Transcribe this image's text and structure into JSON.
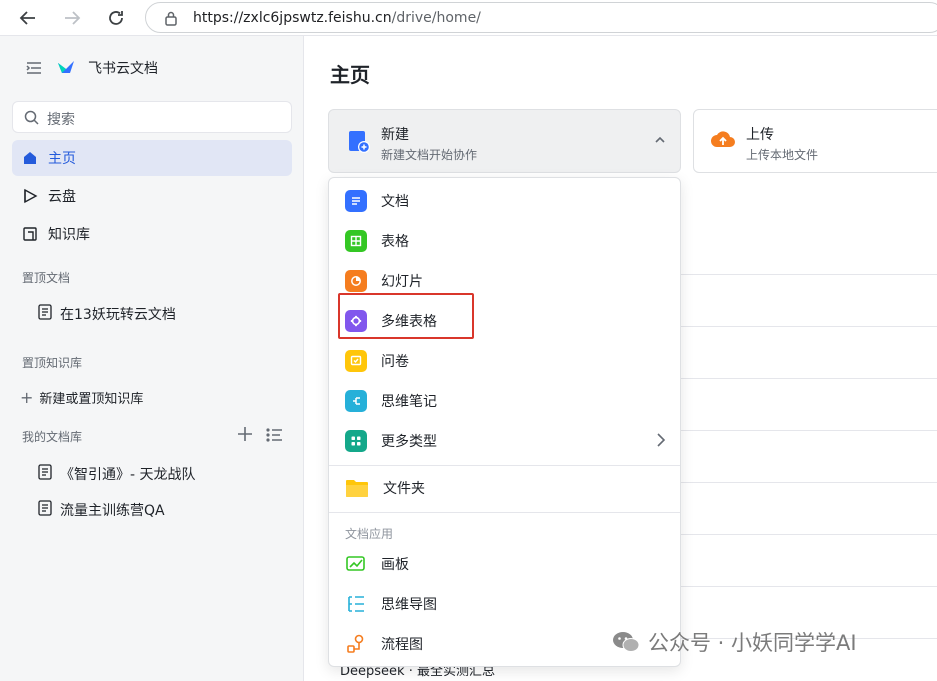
{
  "browser": {
    "url_host": "https://zxlc6jpswtz.feishu.cn",
    "url_path": "/drive/home/"
  },
  "sidebar": {
    "brand": "飞书云文档",
    "search_placeholder": "搜索",
    "nav": [
      {
        "label": "主页"
      },
      {
        "label": "云盘"
      },
      {
        "label": "知识库"
      }
    ],
    "pinned_docs_title": "置顶文档",
    "pinned_docs": [
      {
        "label": "在13妖玩转云文档"
      }
    ],
    "pinned_lib_title": "置顶知识库",
    "add_lib_label": "新建或置顶知识库",
    "my_lib_title": "我的文档库",
    "my_lib_docs": [
      {
        "label": "《智引通》- 天龙战队"
      },
      {
        "label": "流量主训练营QA"
      }
    ]
  },
  "main": {
    "title": "主页",
    "new_card": {
      "title": "新建",
      "subtitle": "新建文档开始协作"
    },
    "upload_card": {
      "title": "上传",
      "subtitle": "上传本地文件"
    },
    "peek_text": "Deepseek · 最全实测汇总"
  },
  "menu": {
    "items": [
      {
        "label": "文档",
        "icon": "doc-icon",
        "color": "#3370ff"
      },
      {
        "label": "表格",
        "icon": "sheet-icon",
        "color": "#34c724"
      },
      {
        "label": "幻灯片",
        "icon": "slides-icon",
        "color": "#f57d1f"
      },
      {
        "label": "多维表格",
        "icon": "bitable-icon",
        "color": "#8157ed"
      },
      {
        "label": "问卷",
        "icon": "survey-icon",
        "color": "#ffc60a"
      },
      {
        "label": "思维笔记",
        "icon": "mindnote-icon",
        "color": "#26b0d9"
      },
      {
        "label": "更多类型",
        "icon": "more-types-icon",
        "color": "#14a88a"
      }
    ],
    "folder_label": "文件夹",
    "apps_title": "文档应用",
    "apps": [
      {
        "label": "画板",
        "icon": "whiteboard-icon",
        "color": "#34c724"
      },
      {
        "label": "思维导图",
        "icon": "mindmap-icon",
        "color": "#26b0d9"
      },
      {
        "label": "流程图",
        "icon": "flowchart-icon",
        "color": "#f57d1f"
      }
    ]
  },
  "watermark": "公众号 · 小妖同学学AI"
}
